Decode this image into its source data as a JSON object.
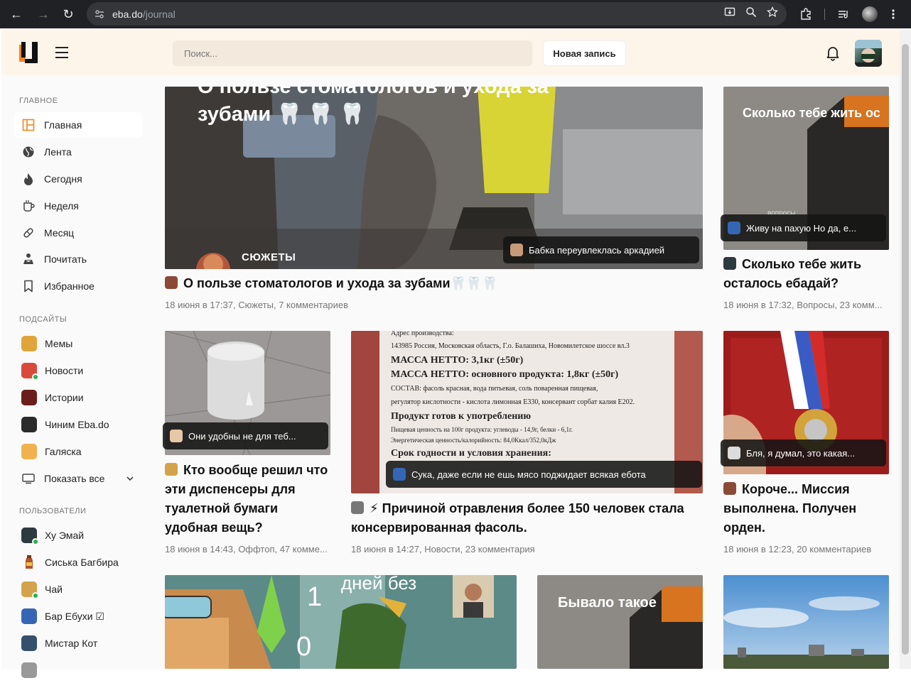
{
  "browser": {
    "url_host": "eba.do",
    "url_path": "/journal"
  },
  "header": {
    "search_placeholder": "Поиск...",
    "new_post_label": "Новая запись"
  },
  "sidebar": {
    "main_title": "ГЛАВНОЕ",
    "main_items": [
      {
        "label": "Главная",
        "icon": "home-icon",
        "active": true
      },
      {
        "label": "Лента",
        "icon": "globe-icon"
      },
      {
        "label": "Сегодня",
        "icon": "flame-icon"
      },
      {
        "label": "Неделя",
        "icon": "cup-icon"
      },
      {
        "label": "Месяц",
        "icon": "pill-icon"
      },
      {
        "label": "Почитать",
        "icon": "reader-icon"
      },
      {
        "label": "Избранное",
        "icon": "bookmark-icon"
      }
    ],
    "subsites_title": "ПОДСАЙТЫ",
    "subsites": [
      {
        "label": "Мемы",
        "color": "#e0a43a"
      },
      {
        "label": "Новости",
        "color": "#d94a3b"
      },
      {
        "label": "Истории",
        "color": "#6b1d1d"
      },
      {
        "label": "Чиним Eba.do",
        "color": "#2a2a2a"
      },
      {
        "label": "Галяска",
        "color": "#f0b24f"
      }
    ],
    "show_all_label": "Показать все",
    "users_title": "ПОЛЬЗОВАТЕЛИ",
    "users": [
      {
        "label": "Ху Эмай",
        "color": "#2d3a40"
      },
      {
        "label": "Сиська Багбира",
        "color": "#b0522a"
      },
      {
        "label": "Чай",
        "color": "#d3a24a"
      },
      {
        "label": "Бар Ебухи ☑",
        "color": "#3565b5"
      },
      {
        "label": "Мистар Кот",
        "color": "#35506e"
      }
    ]
  },
  "feed": {
    "hero": {
      "overlay_title_top": "О пользе стоматологов и ухода за",
      "overlay_title_bottom": "зубами 🦷 🦷 🦷",
      "badge": "СЮЖЕТЫ",
      "comment": "Бабка переувлеклась аркадией",
      "title": "О пользе стоматологов и ухода за зубами🦷🦷🦷",
      "meta": "18 июня в 17:37, Сюжеты, 7 комментариев"
    },
    "side_top": {
      "overlay_title": "Сколько тебе жить ос",
      "overlay_small": "вопросы",
      "comment": "Живу на пахую Но да, е...",
      "title": "Сколько тебе жить осталось ебадай?",
      "meta": "18 июня в 17:32, Вопросы, 23 комм..."
    },
    "card1": {
      "comment": "Они удобны не для теб...",
      "title": "Кто вообще решил что эти диспенсеры для туалетной бумаги удобная вещь?",
      "meta": "18 июня в 14:43, Оффтоп, 47 комме..."
    },
    "card2": {
      "label_lines": [
        "Адрес производства:",
        "143985 Россия, Московская область, Г.о. Балашиха, Новомилетское шоссе вл.3",
        "МАССА НЕТТО: 3,1кг (±50г)",
        "МАССА НЕТТО: основного продукта: 1,8кг (±50г)",
        "СОСТАВ: фасоль красная, вода питьевая, соль поваренная пищевая,",
        "регулятор кислотности - кислота лимонная E330, консервант сорбат калия E202.",
        "Продукт готов к употреблению",
        "Пищевая ценность на 100г продукта: углеводы - 14,9г, белки - 6,1г.",
        "Энергетическая ценность/калорийность: 84,0Ккал/352,0кДж",
        "Срок годности и условия хранения:"
      ],
      "comment": "Сука, даже если не ешь мясо поджидает всякая ебота",
      "title": "⚡ Причиной отравления более 150 человек стала консервированная фасоль.",
      "meta": "18 июня в 14:27, Новости, 23 комментария"
    },
    "card3": {
      "comment": "Бля, я думал, это какая...",
      "title": "Короче... Миссия выполнена. Получен орден.",
      "meta": "18 июня в 12:23, 20 комментариев"
    },
    "row3": {
      "meme_top": "дней без",
      "meme_num1": "1",
      "meme_num2": "0",
      "mid_overlay": "Бывало такое"
    }
  }
}
